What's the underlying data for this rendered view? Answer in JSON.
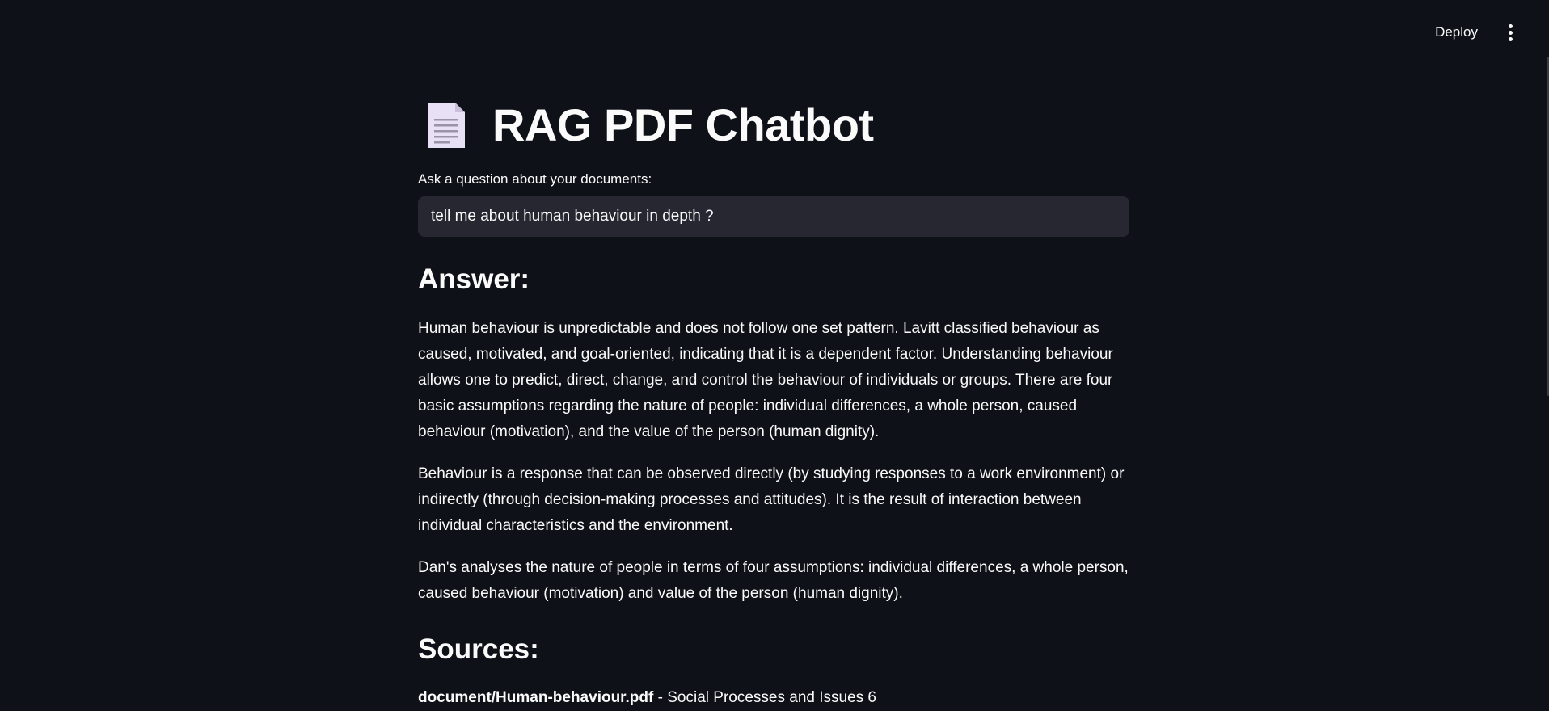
{
  "header": {
    "deploy_label": "Deploy",
    "menu_icon": "kebab-menu-icon"
  },
  "main": {
    "title_icon": "page-facing-up-icon",
    "title": "RAG PDF Chatbot",
    "question_label": "Ask a question about your documents:",
    "question_value": "tell me about human behaviour in depth ?",
    "answer_heading": "Answer:",
    "answer_paragraphs": [
      "Human behaviour is unpredictable and does not follow one set pattern. Lavitt classified behaviour as caused, motivated, and goal-oriented, indicating that it is a dependent factor. Understanding behaviour allows one to predict, direct, change, and control the behaviour of individuals or groups. There are four basic assumptions regarding the nature of people: individual differences, a whole person, caused behaviour (motivation), and the value of the person (human dignity).",
      "Behaviour is a response that can be observed directly (by studying responses to a work environment) or indirectly (through decision-making processes and attitudes). It is the result of interaction between individual characteristics and the environment.",
      "Dan's analyses the nature of people in terms of four assumptions: individual differences, a whole person, caused behaviour (motivation) and value of the person (human dignity)."
    ],
    "sources_heading": "Sources:",
    "sources": [
      {
        "file": "document/Human-behaviour.pdf",
        "detail": " - Social Processes and Issues 6"
      }
    ]
  }
}
